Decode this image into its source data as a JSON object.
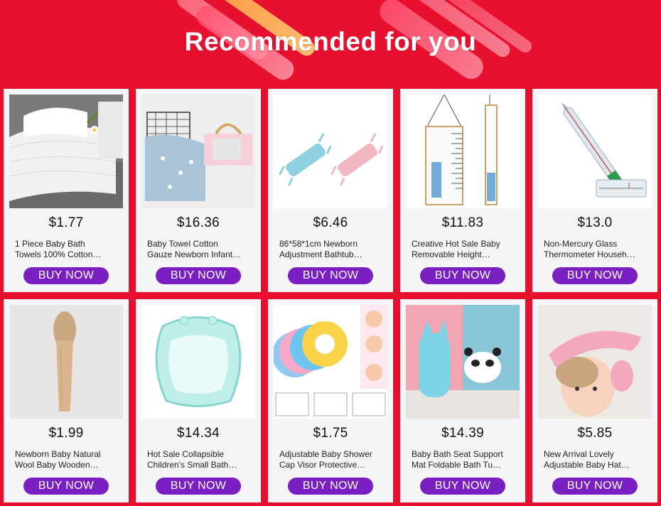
{
  "header": {
    "title": "Recommended for you"
  },
  "colors": {
    "background": "#e8102f",
    "button": "#7a1fc2",
    "card": "#f5f5f7"
  },
  "products": [
    {
      "price": "$1.77",
      "name_line1": "1 Piece Baby Bath",
      "name_line2": "Towels 100% Cotton…",
      "button": "BUY NOW",
      "image": "white-towels-image"
    },
    {
      "price": "$16.36",
      "name_line1": "Baby Towel Cotton",
      "name_line2": "Gauze Newborn Infant…",
      "button": "BUY NOW",
      "image": "blue-towel-basket-image"
    },
    {
      "price": "$6.46",
      "name_line1": "86*58*1cm Newborn",
      "name_line2": "Adjustment Bathtub…",
      "button": "BUY NOW",
      "image": "bath-net-image"
    },
    {
      "price": "$11.83",
      "name_line1": "Creative Hot Sale Baby",
      "name_line2": "Removable Height…",
      "button": "BUY NOW",
      "image": "height-chart-image"
    },
    {
      "price": "$13.0",
      "name_line1": "Non-Mercury Glass",
      "name_line2": "Thermometer Househ…",
      "button": "BUY NOW",
      "image": "thermometer-image"
    },
    {
      "price": "$1.99",
      "name_line1": "Newborn Baby Natural",
      "name_line2": "Wool Baby Wooden…",
      "button": "BUY NOW",
      "image": "wooden-brush-image"
    },
    {
      "price": "$14.34",
      "name_line1": "Hot Sale Collapsible",
      "name_line2": "Children's Small Bath…",
      "button": "BUY NOW",
      "image": "collapsible-tub-image"
    },
    {
      "price": "$1.75",
      "name_line1": "Adjustable Baby Shower",
      "name_line2": "Cap Visor Protective…",
      "button": "BUY NOW",
      "image": "shower-caps-image"
    },
    {
      "price": "$14.39",
      "name_line1": "Baby Bath Seat Support",
      "name_line2": "Mat Foldable Bath Tu…",
      "button": "BUY NOW",
      "image": "bath-seat-image"
    },
    {
      "price": "$5.85",
      "name_line1": "New Arrival Lovely",
      "name_line2": "Adjustable Baby Hat…",
      "button": "BUY NOW",
      "image": "baby-hat-image"
    }
  ]
}
